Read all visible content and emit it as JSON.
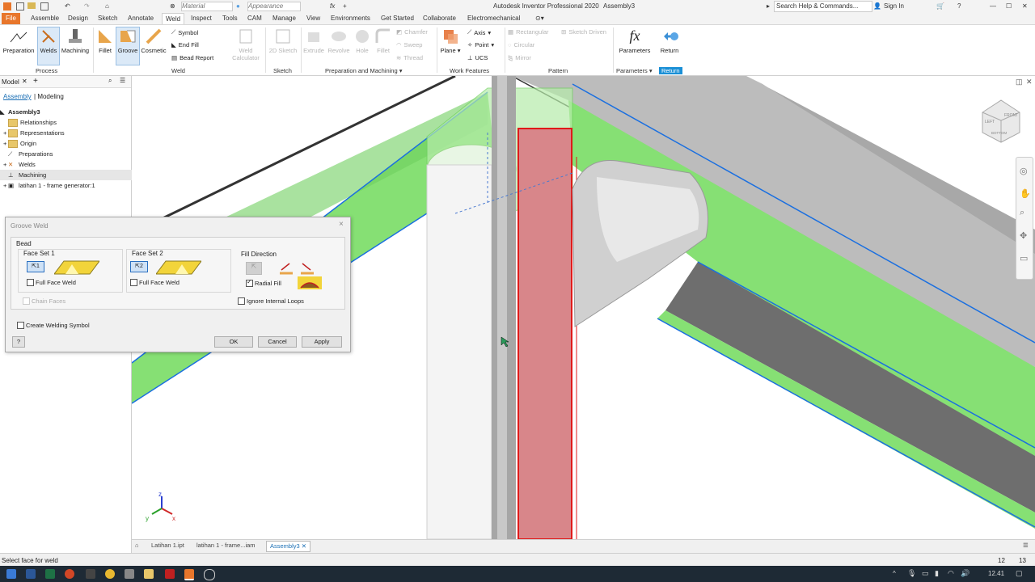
{
  "titlebar": {
    "material": "Material",
    "appearance": "Appearance",
    "app_title": "Autodesk Inventor Professional 2020",
    "doc_title": "Assembly3",
    "search_placeholder": "Search Help & Commands...",
    "sign_in": "Sign In",
    "minimize": "—",
    "maximize": "☐",
    "close": "✕"
  },
  "menu": {
    "file": "File",
    "tabs": [
      "Assemble",
      "Design",
      "Sketch",
      "Annotate",
      "Weld",
      "Inspect",
      "Tools",
      "CAM",
      "Manage",
      "View",
      "Environments",
      "Get Started",
      "Collaborate",
      "Electromechanical"
    ]
  },
  "ribbon": {
    "process": {
      "preparation": "Preparation",
      "welds": "Welds",
      "machining": "Machining",
      "label": "Process"
    },
    "weld": {
      "fillet": "Fillet",
      "groove": "Groove",
      "cosmetic": "Cosmetic",
      "symbol": "Symbol",
      "end_fill": "End Fill",
      "bead_report": "Bead Report",
      "weld_calculator": "Weld Calculator",
      "label": "Weld"
    },
    "sketch": {
      "sketch_2d": "2D Sketch",
      "label": "Sketch"
    },
    "prep": {
      "extrude": "Extrude",
      "revolve": "Revolve",
      "hole": "Hole",
      "fillet": "Fillet",
      "chamfer": "Chamfer",
      "sweep": "Sweep",
      "thread": "Thread",
      "label": "Preparation and Machining"
    },
    "work": {
      "plane": "Plane",
      "axis": "Axis",
      "point": "Point",
      "ucs": "UCS",
      "label": "Work Features"
    },
    "pattern": {
      "rectangular": "Rectangular",
      "circular": "Circular",
      "sketch_driven": "Sketch Driven",
      "mirror": "Mirror",
      "label": "Pattern"
    },
    "params": {
      "parameters": "Parameters",
      "fx": "fx",
      "label": "Parameters"
    },
    "ret": {
      "return": "Return",
      "label": "Return"
    }
  },
  "browser": {
    "title": "Model",
    "add": "+",
    "tab_assembly": "Assembly",
    "tab_modeling": "Modeling",
    "items": [
      {
        "label": "Assembly3"
      },
      {
        "label": "Relationships"
      },
      {
        "label": "Representations"
      },
      {
        "label": "Origin"
      },
      {
        "label": "Preparations"
      },
      {
        "label": "Welds"
      },
      {
        "label": "Machining"
      },
      {
        "label": "latihan 1 - frame generator:1"
      }
    ]
  },
  "dialog": {
    "title": "Groove Weld",
    "bead": "Bead",
    "face_set_1": "Face Set 1",
    "face_set_2": "Face Set 2",
    "fs1_btn": "1",
    "fs2_btn": "2",
    "full_face_weld_1": "Full Face Weld",
    "full_face_weld_2": "Full Face Weld",
    "chain_faces": "Chain Faces",
    "fill_direction": "Fill Direction",
    "radial_fill": "Radial Fill",
    "ignore_internal_loops": "Ignore Internal Loops",
    "create_welding_symbol": "Create Welding Symbol",
    "help": "?",
    "ok": "OK",
    "cancel": "Cancel",
    "apply": "Apply",
    "close": "×"
  },
  "doctabs": {
    "tabs": [
      "Latihan 1.ipt",
      "latihan 1 - frame...iam",
      "Assembly3"
    ]
  },
  "status": {
    "text": "Select face for weld",
    "n1": "12",
    "n2": "13"
  },
  "taskbar": {
    "time": "12.41"
  },
  "triad": {
    "x": "x",
    "y": "y",
    "z": "z"
  },
  "viewcube": {
    "left": "LEFT",
    "front": "FRONT",
    "bottom": "BOTTOM"
  },
  "colors": {
    "weld_green": "#7fe06a",
    "selection_red": "#d8868a",
    "accent_blue": "#1a6fb5",
    "file_orange": "#e8762b"
  }
}
